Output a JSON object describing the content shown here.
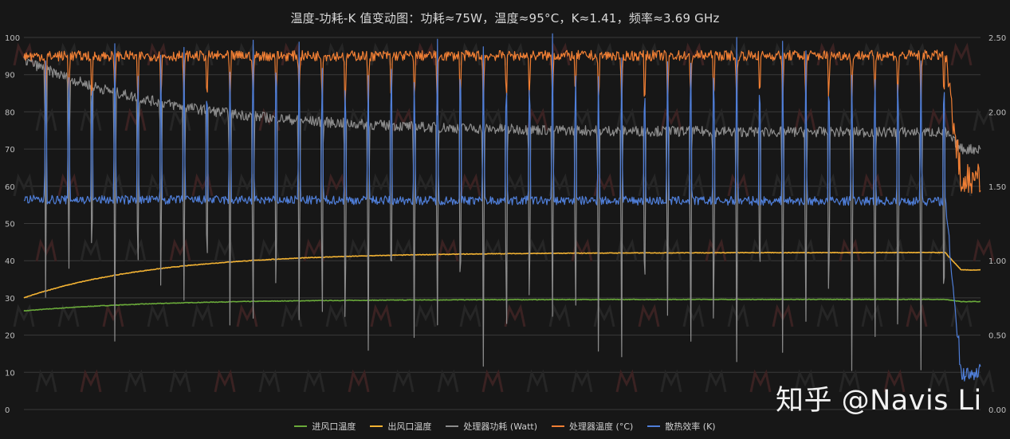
{
  "title": "温度-功耗-K 值变动图：功耗≈75W，温度≈95°C，K≈1.41，频率≈3.69 GHz",
  "watermark": {
    "text": "知乎 @Navis Li",
    "logo_icon": "stylized-m-logo-icon"
  },
  "chart_data": {
    "type": "line",
    "left_axis": {
      "min": 0,
      "max": 100,
      "ticks": [
        0,
        10,
        20,
        30,
        40,
        50,
        60,
        70,
        80,
        90,
        100
      ],
      "tick_labels": [
        "0",
        "10",
        "20",
        "30",
        "40",
        "50",
        "60",
        "70",
        "80",
        "90",
        "100"
      ]
    },
    "right_axis": {
      "min": 0,
      "max": 2.5,
      "ticks": [
        0,
        0.5,
        1.0,
        1.5,
        2.0,
        2.5
      ],
      "tick_labels": [
        "0.00",
        "0.50",
        "1.00",
        "1.50",
        "2.00",
        "2.50"
      ]
    },
    "x_samples": 1190,
    "grid": "horizontal",
    "legend_position": "bottom",
    "cycles": {
      "count": 40,
      "end_sample": 1145
    },
    "series": [
      {
        "name": "进风口温度",
        "axis": "left",
        "color": "#6aaa3a",
        "shape": "rise",
        "start": 26.5,
        "end": 29.6,
        "tail_value": 29.0,
        "dip_depth": 0
      },
      {
        "name": "出风口温度",
        "axis": "left",
        "color": "#f2b233",
        "shape": "rise",
        "start": 30.0,
        "end": 42.2,
        "tail_value": 37.5,
        "dip_depth": 0
      },
      {
        "name": "处理器功耗 (Watt)",
        "axis": "left",
        "color": "#8c8c8c",
        "shape": "decay",
        "start": 94.0,
        "end": 74.5,
        "tail_value": 70.0,
        "dip_depth": 65
      },
      {
        "name": "处理器温度 (°C)",
        "axis": "left",
        "color": "#f07f34",
        "shape": "flat",
        "start": 95.0,
        "end": 95.2,
        "tail_value": 62.0,
        "dip_depth": 16
      },
      {
        "name": "散热效率 (K)",
        "axis": "right",
        "color": "#4f7ed8",
        "shape": "flat",
        "start": 1.41,
        "end": 1.4,
        "tail_value": 0.25,
        "dip_depth": -1.15
      }
    ]
  }
}
